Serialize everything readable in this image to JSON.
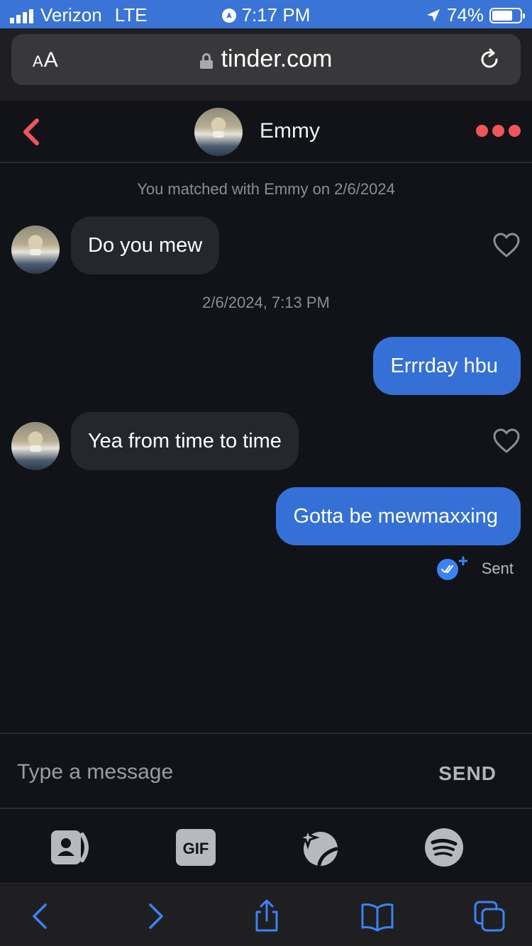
{
  "status_bar": {
    "carrier": "Verizon",
    "network": "LTE",
    "time": "7:17 PM",
    "battery_percent": "74%",
    "battery_level": 0.74
  },
  "browser": {
    "text_size_label_small": "A",
    "text_size_label_large": "A",
    "url": "tinder.com"
  },
  "chat_header": {
    "name": "Emmy",
    "accent_color": "#f2545b"
  },
  "conversation": {
    "match_note": "You matched with Emmy on 2/6/2024",
    "timestamp": "2/6/2024, 7:13 PM",
    "messages": [
      {
        "direction": "incoming",
        "text": "Do you mew"
      },
      {
        "direction": "outgoing",
        "text": "Errrday hbu"
      },
      {
        "direction": "incoming",
        "text": "Yea from time to time"
      },
      {
        "direction": "outgoing",
        "text": "Gotta be mewmaxxing"
      }
    ],
    "sent_status": "Sent"
  },
  "composer": {
    "placeholder": "Type a message",
    "send_label": "SEND",
    "gif_label": "GIF"
  },
  "colors": {
    "background": "#111318",
    "incoming_bubble": "#24272d",
    "outgoing_bubble": "#3470d6",
    "status_bar": "#3a74d6",
    "safari_icons": "#3b82f6"
  }
}
